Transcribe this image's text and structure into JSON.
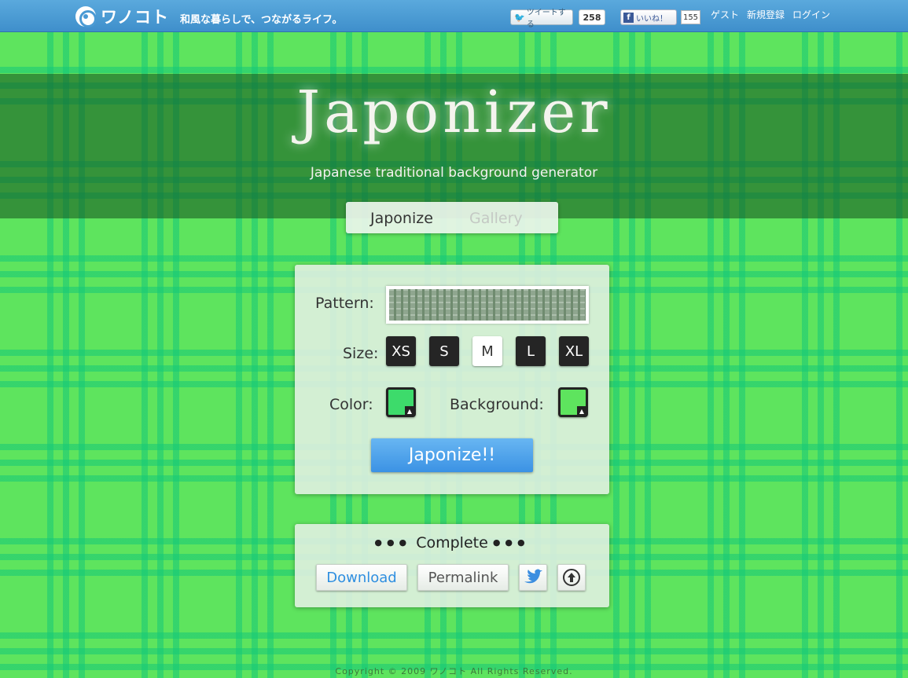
{
  "topbar": {
    "logo_text": "ワノコト",
    "tagline": "和風な暮らしで、つながるライフ。",
    "tweet_label": "ツイートする",
    "tweet_count": "258",
    "like_label": "いいね！",
    "like_count": "155",
    "nav": [
      "ゲスト",
      "新規登録",
      "ログイン"
    ]
  },
  "hero": {
    "title": "Japonizer",
    "subtitle": "Japanese traditional background generator"
  },
  "tabs": [
    "Japonize",
    "Gallery"
  ],
  "form": {
    "pattern_label": "Pattern:",
    "size_label": "Size:",
    "sizes": [
      "XS",
      "S",
      "M",
      "L",
      "XL"
    ],
    "selected_size": "M",
    "color_label": "Color:",
    "background_label": "Background:",
    "color_value": "#3ddb6b",
    "background_value": "#5ee45e",
    "submit_label": "Japonize!!"
  },
  "complete": {
    "dots": "●●●",
    "title": "Complete",
    "download_label": "Download",
    "permalink_label": "Permalink"
  },
  "footer": {
    "copyright": "Copyright © 2009 ワノコト All Rights Reserved."
  }
}
